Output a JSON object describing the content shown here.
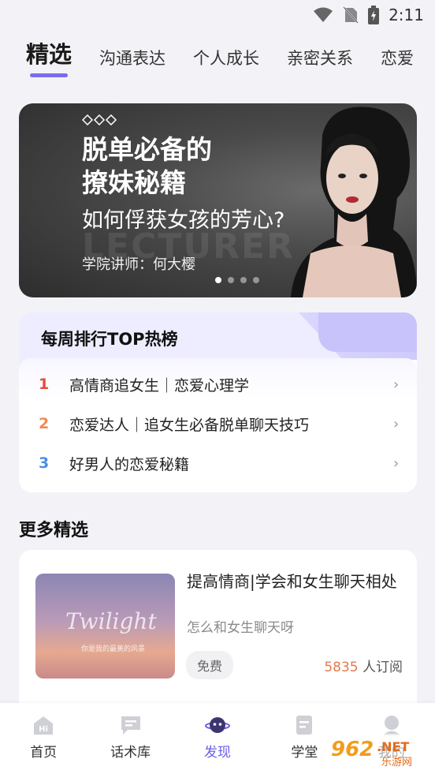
{
  "status_bar": {
    "time": "2:11"
  },
  "tabs": [
    {
      "label": "精选",
      "active": true
    },
    {
      "label": "沟通表达"
    },
    {
      "label": "个人成长"
    },
    {
      "label": "亲密关系"
    },
    {
      "label": "恋爱"
    }
  ],
  "banner": {
    "title_line1": "脱单必备的",
    "title_line2": "撩妹秘籍",
    "subtitle": "如何俘获女孩的芳心?",
    "bg_word": "LECTURER",
    "lecturer": "学院讲师：何大樱",
    "slide_count": 4,
    "current_slide": 1
  },
  "ranking": {
    "title": "每周排行TOP热榜",
    "items": [
      {
        "rank": "1",
        "text": "高情商追女生｜恋爱心理学",
        "color": "#e8493a"
      },
      {
        "rank": "2",
        "text": "恋爱达人｜追女生必备脱单聊天技巧",
        "color": "#f08a55"
      },
      {
        "rank": "3",
        "text": "好男人的恋爱秘籍",
        "color": "#4a90e2"
      }
    ]
  },
  "more": {
    "title": "更多精选",
    "course": {
      "thumb_word": "Twilight",
      "thumb_small": "你是我的最美的风景",
      "title": "提高情商|学会和女生聊天相处",
      "subtitle": "怎么和女生聊天呀",
      "tag": "免费",
      "subscribers": "5835",
      "subscribers_unit": " 人订阅"
    }
  },
  "bottom_nav": [
    {
      "label": "首页",
      "icon": "home-icon"
    },
    {
      "label": "话术库",
      "icon": "chat-icon"
    },
    {
      "label": "发现",
      "icon": "discover-icon",
      "active": true
    },
    {
      "label": "学堂",
      "icon": "school-icon"
    },
    {
      "label": "我的",
      "icon": "profile-icon"
    }
  ],
  "watermark": {
    "text": "962.NET",
    "sub": "乐游网"
  },
  "colors": {
    "accent": "#7a6cf0",
    "subs_count": "#e5794c"
  }
}
